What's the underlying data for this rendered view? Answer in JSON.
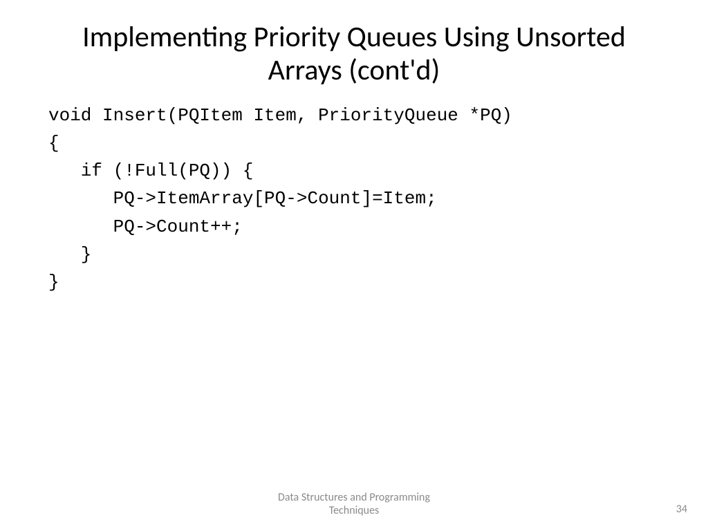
{
  "slide": {
    "title": "Implementing Priority Queues Using Unsorted Arrays (cont'd)",
    "code": {
      "line1": "void Insert(PQItem Item, PriorityQueue *PQ)",
      "line2": "{",
      "line3": "   if (!Full(PQ)) {",
      "line4": "      PQ->ItemArray[PQ->Count]=Item;",
      "line5": "      PQ->Count++;",
      "line6": "   }",
      "line7": "}"
    },
    "footer_line1": "Data Structures and Programming",
    "footer_line2": "Techniques",
    "page_number": "34"
  }
}
